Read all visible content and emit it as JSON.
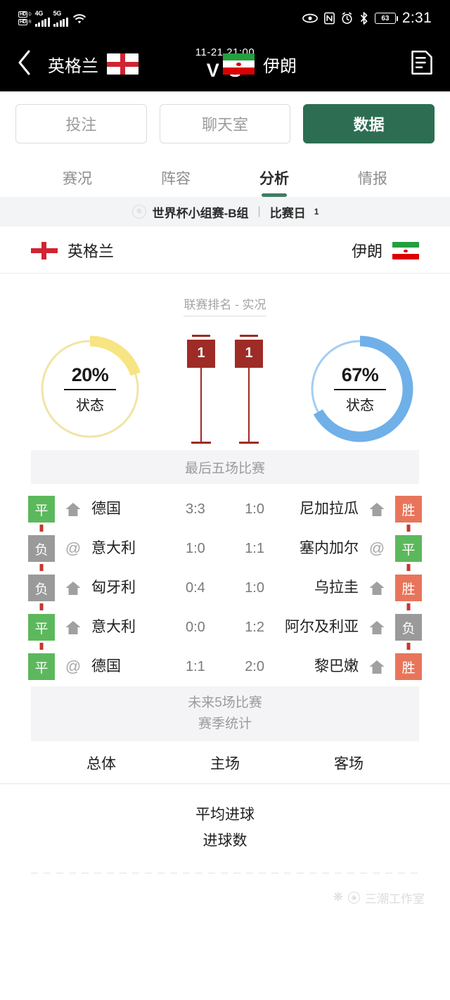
{
  "statusbar": {
    "net1_label": "4G",
    "net2_label": "5G",
    "hd_label": "HD",
    "hd_sub1": "D",
    "hd_sub2": "R",
    "battery": "63",
    "time": "2:31",
    "icons": [
      "eye-icon",
      "nfc-icon",
      "alarm-icon",
      "bluetooth-icon",
      "battery-icon"
    ]
  },
  "header": {
    "back": "back-icon",
    "home_team": "英格兰",
    "home_flag": "england-flag",
    "away_team": "伊朗",
    "away_flag": "iran-flag",
    "date": "11-21 21:00",
    "vs": "V S",
    "menu": "document-icon"
  },
  "segments": [
    {
      "label": "投注",
      "active": false
    },
    {
      "label": "聊天室",
      "active": false
    },
    {
      "label": "数据",
      "active": true
    }
  ],
  "tabs": [
    {
      "label": "赛况",
      "active": false
    },
    {
      "label": "阵容",
      "active": false
    },
    {
      "label": "分析",
      "active": true
    },
    {
      "label": "情报",
      "active": false
    }
  ],
  "league": {
    "name": "世界杯小组赛-B组",
    "separator": "|",
    "matchday_label": "比赛日",
    "matchday_num": "1"
  },
  "teamrow": {
    "home": "英格兰",
    "away": "伊朗"
  },
  "ranking": {
    "label": "联赛排名 - 实况",
    "home": {
      "percent": "20%",
      "sub": "状态",
      "value": 20,
      "color": "#f6e27a",
      "track": "#f2e6a8"
    },
    "away": {
      "percent": "67%",
      "sub": "状态",
      "value": 67,
      "color": "#6eb0e8",
      "track": "#9ec9ee"
    },
    "markers": [
      {
        "rank": "1"
      },
      {
        "rank": "1"
      }
    ]
  },
  "last5": {
    "title": "最后五场比赛",
    "home_matches": [
      {
        "result": "平",
        "result_type": "draw",
        "venue": "home",
        "venue_icon": "home-icon",
        "opponent": "德国",
        "score": "3:3"
      },
      {
        "result": "负",
        "result_type": "loss",
        "venue": "away",
        "venue_icon": "at-icon",
        "opponent": "意大利",
        "score": "1:0"
      },
      {
        "result": "负",
        "result_type": "loss",
        "venue": "home",
        "venue_icon": "home-icon",
        "opponent": "匈牙利",
        "score": "0:4"
      },
      {
        "result": "平",
        "result_type": "draw",
        "venue": "home",
        "venue_icon": "home-icon",
        "opponent": "意大利",
        "score": "0:0"
      },
      {
        "result": "平",
        "result_type": "draw",
        "venue": "away",
        "venue_icon": "at-icon",
        "opponent": "德国",
        "score": "1:1"
      }
    ],
    "away_matches": [
      {
        "score": "1:0",
        "opponent": "尼加拉瓜",
        "venue": "home",
        "venue_icon": "home-icon",
        "result": "胜",
        "result_type": "win"
      },
      {
        "score": "1:1",
        "opponent": "塞内加尔",
        "venue": "away",
        "venue_icon": "at-icon",
        "result": "平",
        "result_type": "draw"
      },
      {
        "score": "1:0",
        "opponent": "乌拉圭",
        "venue": "home",
        "venue_icon": "home-icon",
        "result": "胜",
        "result_type": "win"
      },
      {
        "score": "1:2",
        "opponent": "阿尔及利亚",
        "venue": "home",
        "venue_icon": "home-icon",
        "result": "负",
        "result_type": "loss"
      },
      {
        "score": "2:0",
        "opponent": "黎巴嫩",
        "venue": "home",
        "venue_icon": "home-icon",
        "result": "胜",
        "result_type": "win"
      }
    ]
  },
  "season": {
    "title_line1": "未来5场比赛",
    "title_line2": "赛季统计",
    "columns": [
      "总体",
      "主场",
      "客场"
    ],
    "rows": [
      "平均进球",
      "进球数"
    ]
  },
  "watermark": {
    "text": "三潮工作室"
  }
}
